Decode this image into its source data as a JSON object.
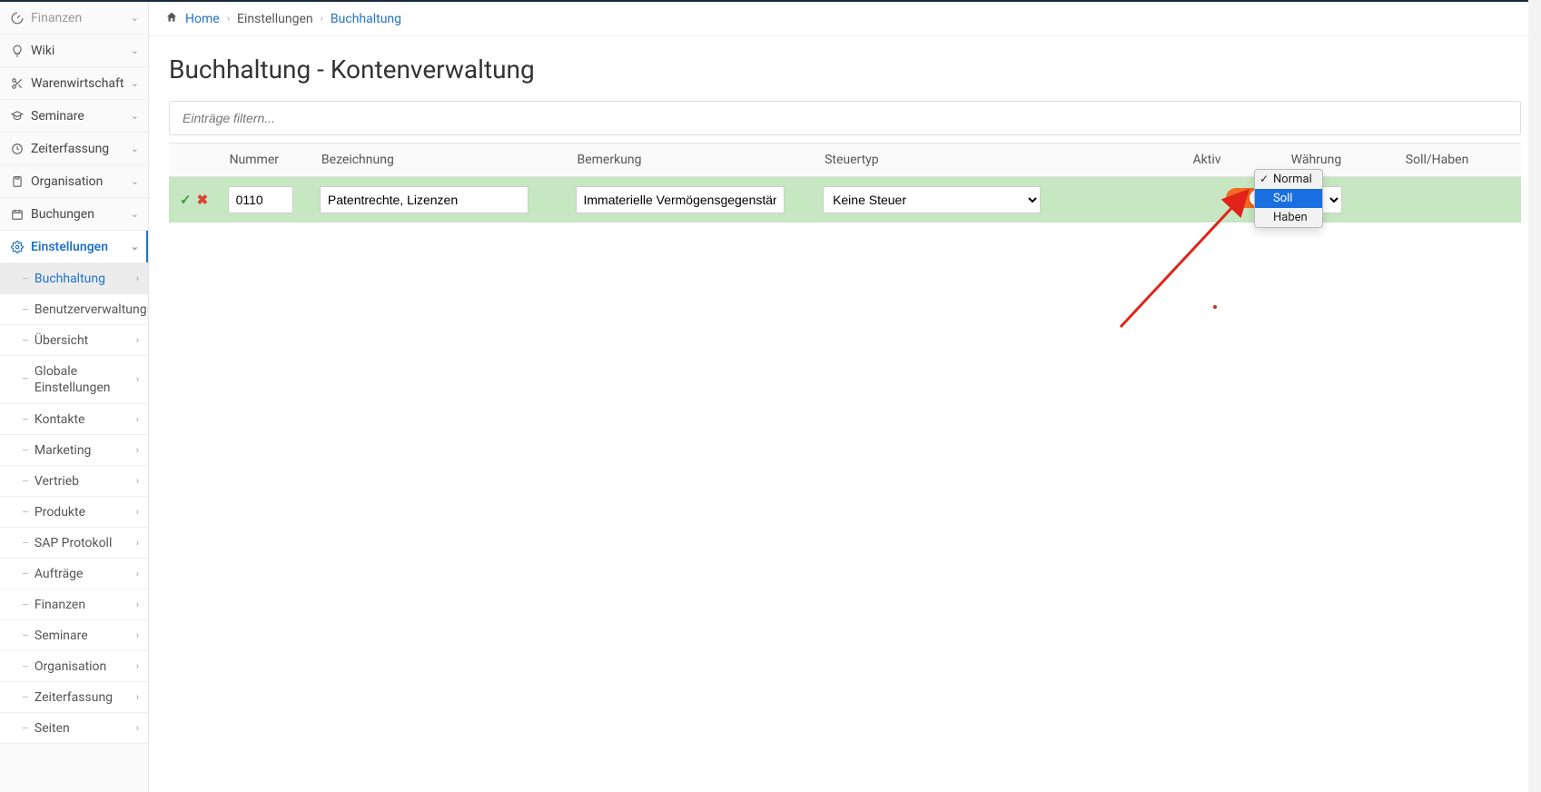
{
  "breadcrumb": {
    "home": "Home",
    "mid": "Einstellungen",
    "last": "Buchhaltung"
  },
  "page": {
    "title": "Buchhaltung - Kontenverwaltung",
    "filterPlaceholder": "Einträge filtern..."
  },
  "sidebar": {
    "items": [
      {
        "label": "Finanzen",
        "icon": "gauge",
        "dim": true
      },
      {
        "label": "Wiki",
        "icon": "bulb"
      },
      {
        "label": "Warenwirtschaft",
        "icon": "scissors"
      },
      {
        "label": "Seminare",
        "icon": "grad"
      },
      {
        "label": "Zeiterfassung",
        "icon": "clock"
      },
      {
        "label": "Organisation",
        "icon": "clipboard"
      },
      {
        "label": "Buchungen",
        "icon": "calendar"
      },
      {
        "label": "Einstellungen",
        "icon": "gear",
        "active": true
      }
    ],
    "sub": [
      {
        "label": "Buchhaltung",
        "selected": true
      },
      {
        "label": "Benutzerverwaltung"
      },
      {
        "label": "Übersicht"
      },
      {
        "label": "Globale Einstellungen",
        "tall": true
      },
      {
        "label": "Kontakte"
      },
      {
        "label": "Marketing"
      },
      {
        "label": "Vertrieb"
      },
      {
        "label": "Produkte"
      },
      {
        "label": "SAP Protokoll"
      },
      {
        "label": "Aufträge"
      },
      {
        "label": "Finanzen"
      },
      {
        "label": "Seminare"
      },
      {
        "label": "Organisation"
      },
      {
        "label": "Zeiterfassung"
      },
      {
        "label": "Seiten"
      }
    ]
  },
  "table": {
    "headers": {
      "nummer": "Nummer",
      "bez": "Bezeichnung",
      "bem": "Bemerkung",
      "steuer": "Steuertyp",
      "aktiv": "Aktiv",
      "waehrung": "Währung",
      "soll": "Soll/Haben"
    },
    "row": {
      "nummer": "0110",
      "bez": "Patentrechte, Lizenzen",
      "bem": "Immaterielle Vermögensgegenstände",
      "steuer": "Keine Steuer",
      "aktiv": true,
      "waehrung": "€",
      "sollOptions": {
        "normal": "Normal",
        "soll": "Soll",
        "haben": "Haben"
      }
    }
  }
}
